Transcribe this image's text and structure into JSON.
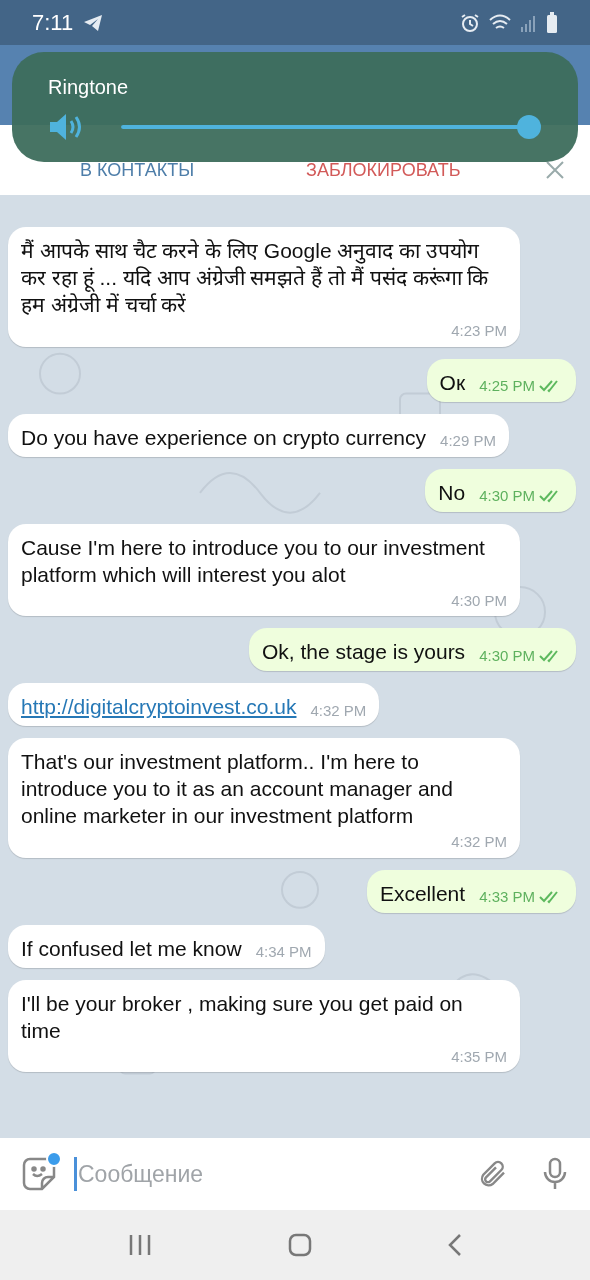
{
  "status_bar": {
    "time": "7:11"
  },
  "contact_bar": {
    "add_label": "В КОНТАКТЫ",
    "block_label": "ЗАБЛОКИРОВАТЬ"
  },
  "volume_popup": {
    "label": "Ringtone",
    "level": 1
  },
  "messages": [
    {
      "kind": "incoming",
      "text": "मैं आपके साथ चैट करने के लिए Google अनुवाद का उपयोग कर रहा हूं ... यदि आप अंग्रेजी समझते हैं तो मैं पसंद करूंगा कि हम अंग्रेजी में चर्चा करें",
      "time": "4:23 PM"
    },
    {
      "kind": "outgoing",
      "text": "Ок",
      "time": "4:25 PM",
      "read": true
    },
    {
      "kind": "incoming",
      "text": "Do you have experience on crypto currency",
      "time": "4:29 PM"
    },
    {
      "kind": "outgoing",
      "text": "No",
      "time": "4:30 PM",
      "read": true
    },
    {
      "kind": "incoming",
      "text": "Cause I'm here to introduce you to our investment platform which will interest you alot",
      "time": "4:30 PM"
    },
    {
      "kind": "outgoing",
      "text": "Ok, the stage is yours",
      "time": "4:30 PM",
      "read": true
    },
    {
      "kind": "link",
      "text": "http://digitalcryptoinvest.co.uk",
      "time": "4:32 PM"
    },
    {
      "kind": "incoming",
      "text": "That's our investment platform.. I'm here to introduce you to it as an account manager and online marketer in our investment platform",
      "time": "4:32 PM"
    },
    {
      "kind": "outgoing",
      "text": "Excellent",
      "time": "4:33 PM",
      "read": true
    },
    {
      "kind": "incoming",
      "text": "If confused let me know",
      "time": "4:34 PM"
    },
    {
      "kind": "incoming",
      "text": "I'll be your broker , making sure you get paid on time",
      "time": "4:35 PM"
    }
  ],
  "composer": {
    "placeholder": "Сообщение"
  }
}
